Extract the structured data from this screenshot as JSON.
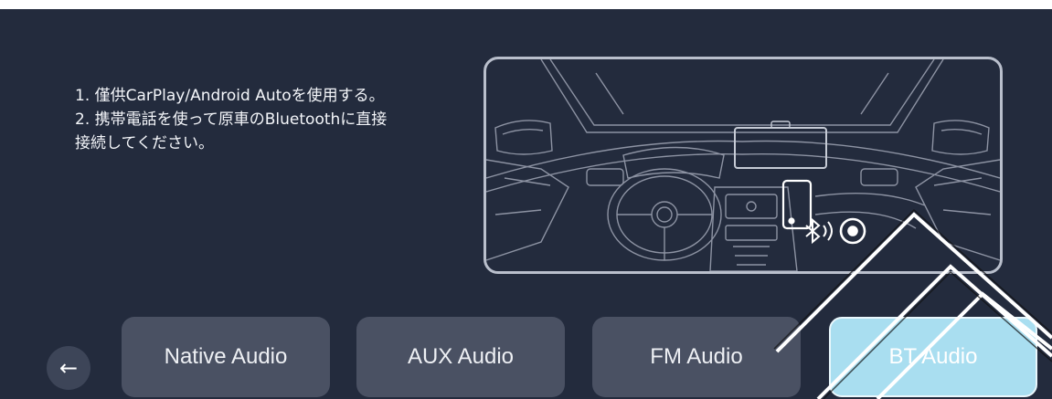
{
  "instructions": [
    "1. 僅供CarPlay/Android Autoを使用する。",
    "2. 携帯電話を使って原車のBluetoothに直接",
    "接続してください。"
  ],
  "back_button": {
    "icon": "←"
  },
  "tabs": [
    {
      "label": "Native Audio",
      "selected": false
    },
    {
      "label": "AUX Audio",
      "selected": false
    },
    {
      "label": "FM Audio",
      "selected": false
    },
    {
      "label": "BT Audio",
      "selected": true
    }
  ],
  "illustration": {
    "bluetooth_icon": "bluetooth",
    "speaker_icon": "speaker"
  },
  "colors": {
    "background": "#232b3d",
    "tab": "#4a5163",
    "tab_selected": "#a9def0",
    "frame": "#b9bfcc"
  }
}
